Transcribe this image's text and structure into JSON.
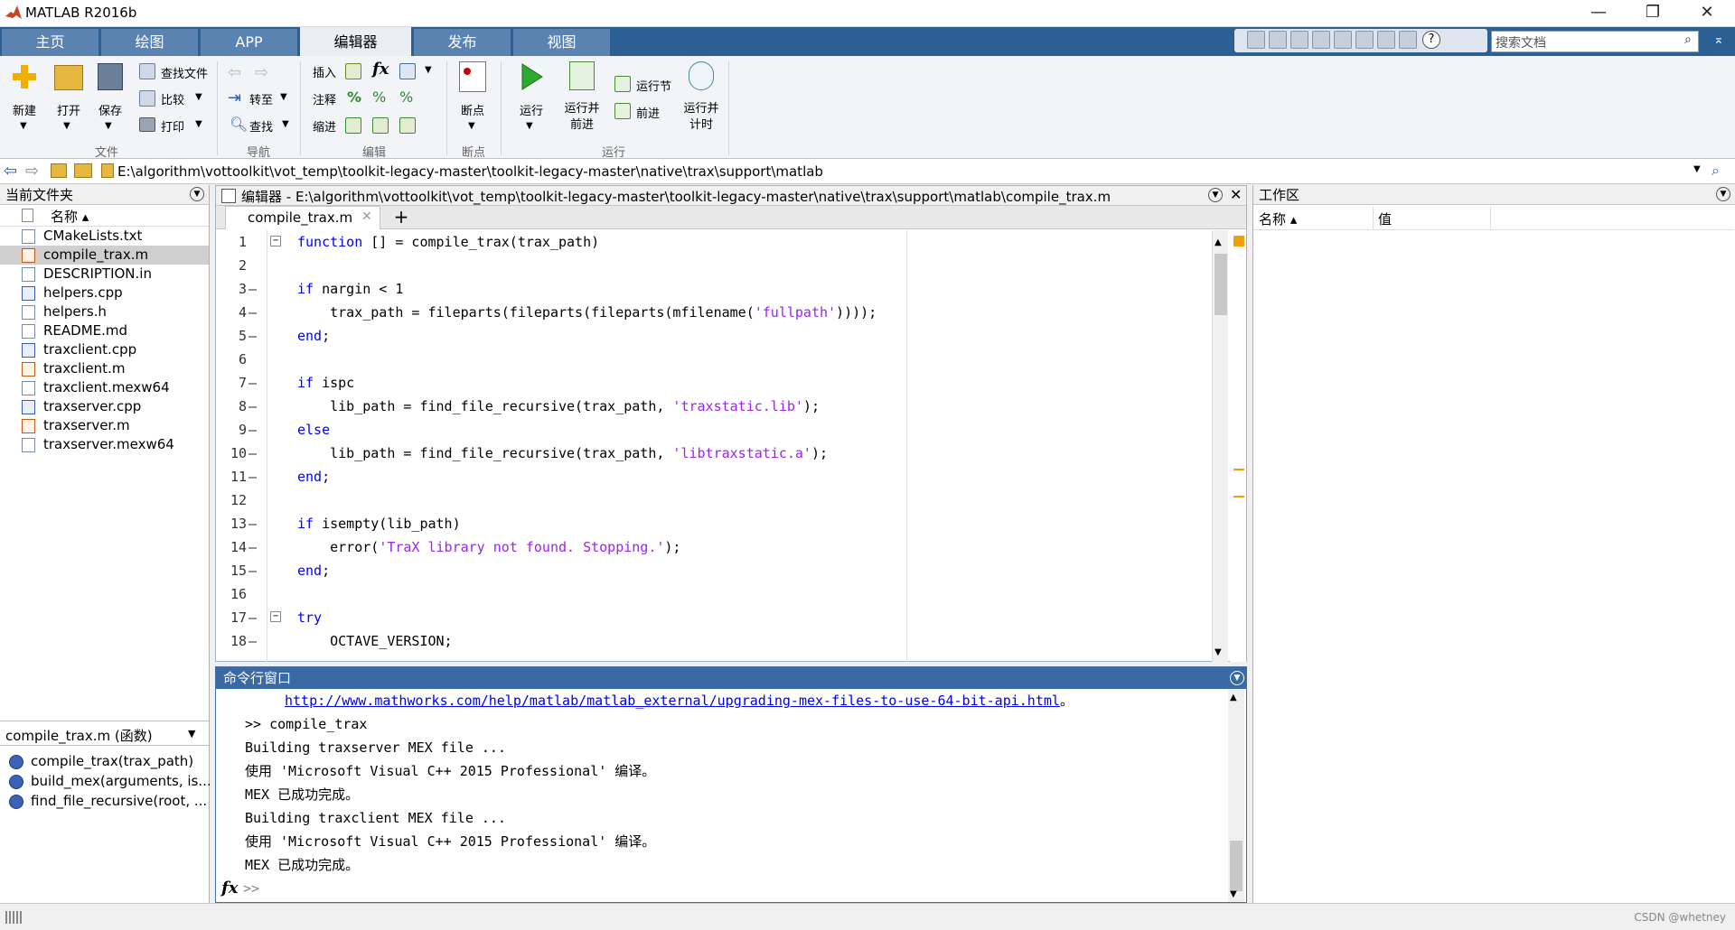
{
  "window": {
    "title": "MATLAB R2016b"
  },
  "tabs": [
    {
      "label": "主页"
    },
    {
      "label": "绘图"
    },
    {
      "label": "APP"
    },
    {
      "label": "编辑器"
    },
    {
      "label": "发布"
    },
    {
      "label": "视图"
    }
  ],
  "search": {
    "placeholder": "搜索文档"
  },
  "ribbon": {
    "file": {
      "new": "新建",
      "open": "打开",
      "save": "保存",
      "find_files": "查找文件",
      "compare": "比较",
      "print": "打印",
      "group": "文件"
    },
    "navigate": {
      "goto": "转至",
      "find": "查找",
      "group": "导航"
    },
    "edit": {
      "insert": "插入",
      "comment": "注释",
      "indent": "缩进",
      "fx": "fx",
      "group": "编辑"
    },
    "breakpoints": {
      "label": "断点",
      "group": "断点"
    },
    "run": {
      "run": "运行",
      "run_advance": "运行并\n前进",
      "run_section": "运行节",
      "advance": "前进",
      "run_time": "运行并\n计时",
      "group": "运行"
    }
  },
  "address": {
    "path": "E:\\algorithm\\vottoolkit\\vot_temp\\toolkit-legacy-master\\toolkit-legacy-master\\native\\trax\\support\\matlab"
  },
  "current_folder": {
    "title": "当前文件夹",
    "column_name": "名称 ▴",
    "files": [
      {
        "name": "CMakeLists.txt",
        "type": "txt"
      },
      {
        "name": "compile_trax.m",
        "type": "m"
      },
      {
        "name": "DESCRIPTION.in",
        "type": "txt"
      },
      {
        "name": "helpers.cpp",
        "type": "cpp"
      },
      {
        "name": "helpers.h",
        "type": "h"
      },
      {
        "name": "README.md",
        "type": "txt"
      },
      {
        "name": "traxclient.cpp",
        "type": "cpp"
      },
      {
        "name": "traxclient.m",
        "type": "m"
      },
      {
        "name": "traxclient.mexw64",
        "type": "mex"
      },
      {
        "name": "traxserver.cpp",
        "type": "cpp"
      },
      {
        "name": "traxserver.m",
        "type": "m"
      },
      {
        "name": "traxserver.mexw64",
        "type": "mex"
      }
    ],
    "detail_title": "compile_trax.m (函数)",
    "functions": [
      "compile_trax(trax_path)",
      "build_mex(arguments, is...",
      "find_file_recursive(root, ..."
    ]
  },
  "editor": {
    "title": "编辑器 - E:\\algorithm\\vottoolkit\\vot_temp\\toolkit-legacy-master\\toolkit-legacy-master\\native\\trax\\support\\matlab\\compile_trax.m",
    "file_tab": "compile_trax.m",
    "add_tab": "+",
    "lines": [
      {
        "n": "1",
        "dash": "",
        "segs": [
          {
            "t": "function",
            "c": "kw"
          },
          {
            "t": " [] = compile_trax(trax_path)",
            "c": ""
          }
        ]
      },
      {
        "n": "2",
        "dash": "",
        "segs": []
      },
      {
        "n": "3",
        "dash": "—",
        "segs": [
          {
            "t": "if",
            "c": "kw"
          },
          {
            "t": " nargin < 1",
            "c": ""
          }
        ]
      },
      {
        "n": "4",
        "dash": "—",
        "segs": [
          {
            "t": "    trax_path = fileparts(fileparts(fileparts(mfilename(",
            "c": ""
          },
          {
            "t": "'fullpath'",
            "c": "str"
          },
          {
            "t": "))));",
            "c": ""
          }
        ]
      },
      {
        "n": "5",
        "dash": "—",
        "segs": [
          {
            "t": "end",
            "c": "kw"
          },
          {
            "t": ";",
            "c": ""
          }
        ]
      },
      {
        "n": "6",
        "dash": "",
        "segs": []
      },
      {
        "n": "7",
        "dash": "—",
        "segs": [
          {
            "t": "if",
            "c": "kw"
          },
          {
            "t": " ispc",
            "c": ""
          }
        ]
      },
      {
        "n": "8",
        "dash": "—",
        "segs": [
          {
            "t": "    lib_path = find_file_recursive(trax_path, ",
            "c": ""
          },
          {
            "t": "'traxstatic.lib'",
            "c": "str"
          },
          {
            "t": ");",
            "c": ""
          }
        ]
      },
      {
        "n": "9",
        "dash": "—",
        "segs": [
          {
            "t": "else",
            "c": "kw"
          }
        ]
      },
      {
        "n": "10",
        "dash": "—",
        "segs": [
          {
            "t": "    lib_path = find_file_recursive(trax_path, ",
            "c": ""
          },
          {
            "t": "'libtraxstatic.a'",
            "c": "str"
          },
          {
            "t": ");",
            "c": ""
          }
        ]
      },
      {
        "n": "11",
        "dash": "—",
        "segs": [
          {
            "t": "end",
            "c": "kw"
          },
          {
            "t": ";",
            "c": ""
          }
        ]
      },
      {
        "n": "12",
        "dash": "",
        "segs": []
      },
      {
        "n": "13",
        "dash": "—",
        "segs": [
          {
            "t": "if",
            "c": "kw"
          },
          {
            "t": " isempty(lib_path)",
            "c": ""
          }
        ]
      },
      {
        "n": "14",
        "dash": "—",
        "segs": [
          {
            "t": "    error(",
            "c": ""
          },
          {
            "t": "'TraX library not found. Stopping.'",
            "c": "str"
          },
          {
            "t": ");",
            "c": ""
          }
        ]
      },
      {
        "n": "15",
        "dash": "—",
        "segs": [
          {
            "t": "end",
            "c": "kw"
          },
          {
            "t": ";",
            "c": ""
          }
        ]
      },
      {
        "n": "16",
        "dash": "",
        "segs": []
      },
      {
        "n": "17",
        "dash": "—",
        "segs": [
          {
            "t": "try",
            "c": "kw"
          }
        ]
      },
      {
        "n": "18",
        "dash": "—",
        "segs": [
          {
            "t": "    OCTAVE_VERSION;",
            "c": ""
          }
        ]
      }
    ]
  },
  "command_window": {
    "title": "命令行窗口",
    "link": "http://www.mathworks.com/help/matlab/matlab_external/upgrading-mex-files-to-use-64-bit-api.html",
    "link_suffix": "。",
    "lines": [
      ">> compile_trax",
      "Building traxserver MEX file ...",
      "使用 'Microsoft Visual C++ 2015 Professional' 编译。",
      "MEX 已成功完成。",
      "Building traxclient MEX file ...",
      "使用 'Microsoft Visual C++ 2015 Professional' 编译。",
      "MEX 已成功完成。"
    ],
    "prompt": ">>",
    "fx": "fx"
  },
  "workspace": {
    "title": "工作区",
    "col_name": "名称 ▴",
    "col_value": "值"
  },
  "statusbar": {
    "watermark": "CSDN @whetney"
  },
  "colors": {
    "tabbar": "#2c5f94",
    "keyword": "#0000ff",
    "string": "#a020f0",
    "link": "#0000ee"
  }
}
